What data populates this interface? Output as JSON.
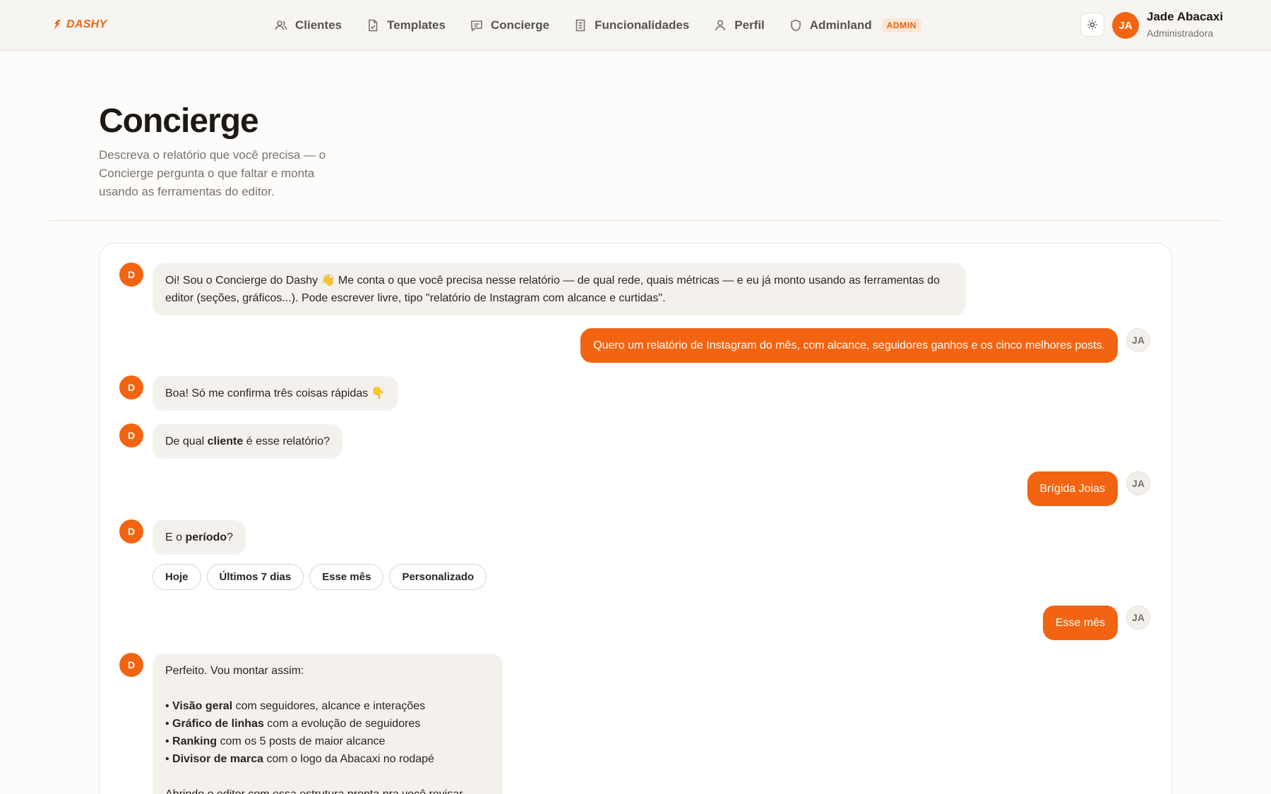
{
  "brand": {
    "name": "DASHY",
    "color": "#f26411"
  },
  "nav": {
    "items": [
      {
        "label": "Clientes",
        "icon": "users-icon"
      },
      {
        "label": "Templates",
        "icon": "file-check-icon"
      },
      {
        "label": "Concierge",
        "icon": "chat-icon"
      },
      {
        "label": "Funcionalidades",
        "icon": "document-icon"
      },
      {
        "label": "Perfil",
        "icon": "user-icon"
      },
      {
        "label": "Adminland",
        "icon": "shield-icon"
      }
    ],
    "admin_badge": "ADMIN"
  },
  "user": {
    "initials": "JA",
    "name": "Jade Abacaxi",
    "role": "Administradora"
  },
  "page": {
    "title": "Concierge",
    "description": "Descreva o relatório que você precisa — o Concierge pergunta o que faltar e monta usando as ferramentas do editor."
  },
  "chat": {
    "bot_initial": "D",
    "me_initials": "JA",
    "messages": {
      "m1": "Oi! Sou o Concierge do Dashy 👋 Me conta o que você precisa nesse relatório — de qual rede, quais métricas — e eu já monto usando as ferramentas do editor (seções, gráficos...). Pode escrever livre, tipo \"relatório de Instagram com alcance e curtidas\".",
      "m2": "Quero um relatório de Instagram do mês, com alcance, seguidores ganhos e os cinco melhores posts.",
      "m3": "Boa! Só me confirma três coisas rápidas 👇",
      "m4_pre": "De qual ",
      "m4_bold": "cliente",
      "m4_post": " é esse relatório?",
      "m5": "Brígida Joias",
      "m6_pre": "E o ",
      "m6_bold": "período",
      "m6_post": "?",
      "m7": "Esse mês",
      "m8_intro": "Perfeito. Vou montar assim:",
      "m8_items": [
        {
          "bold": "Visão geral",
          "rest": " com seguidores, alcance e interações"
        },
        {
          "bold": "Gráfico de linhas",
          "rest": " com a evolução de seguidores"
        },
        {
          "bold": "Ranking",
          "rest": " com os 5 posts de maior alcance"
        },
        {
          "bold": "Divisor de marca",
          "rest": " com o logo da Abacaxi no rodapé"
        }
      ],
      "m8_footer": "Abrindo o editor com essa estrutura pronta pra você revisar."
    },
    "period_options": [
      "Hoje",
      "Últimos 7 dias",
      "Esse mês",
      "Personalizado"
    ]
  }
}
